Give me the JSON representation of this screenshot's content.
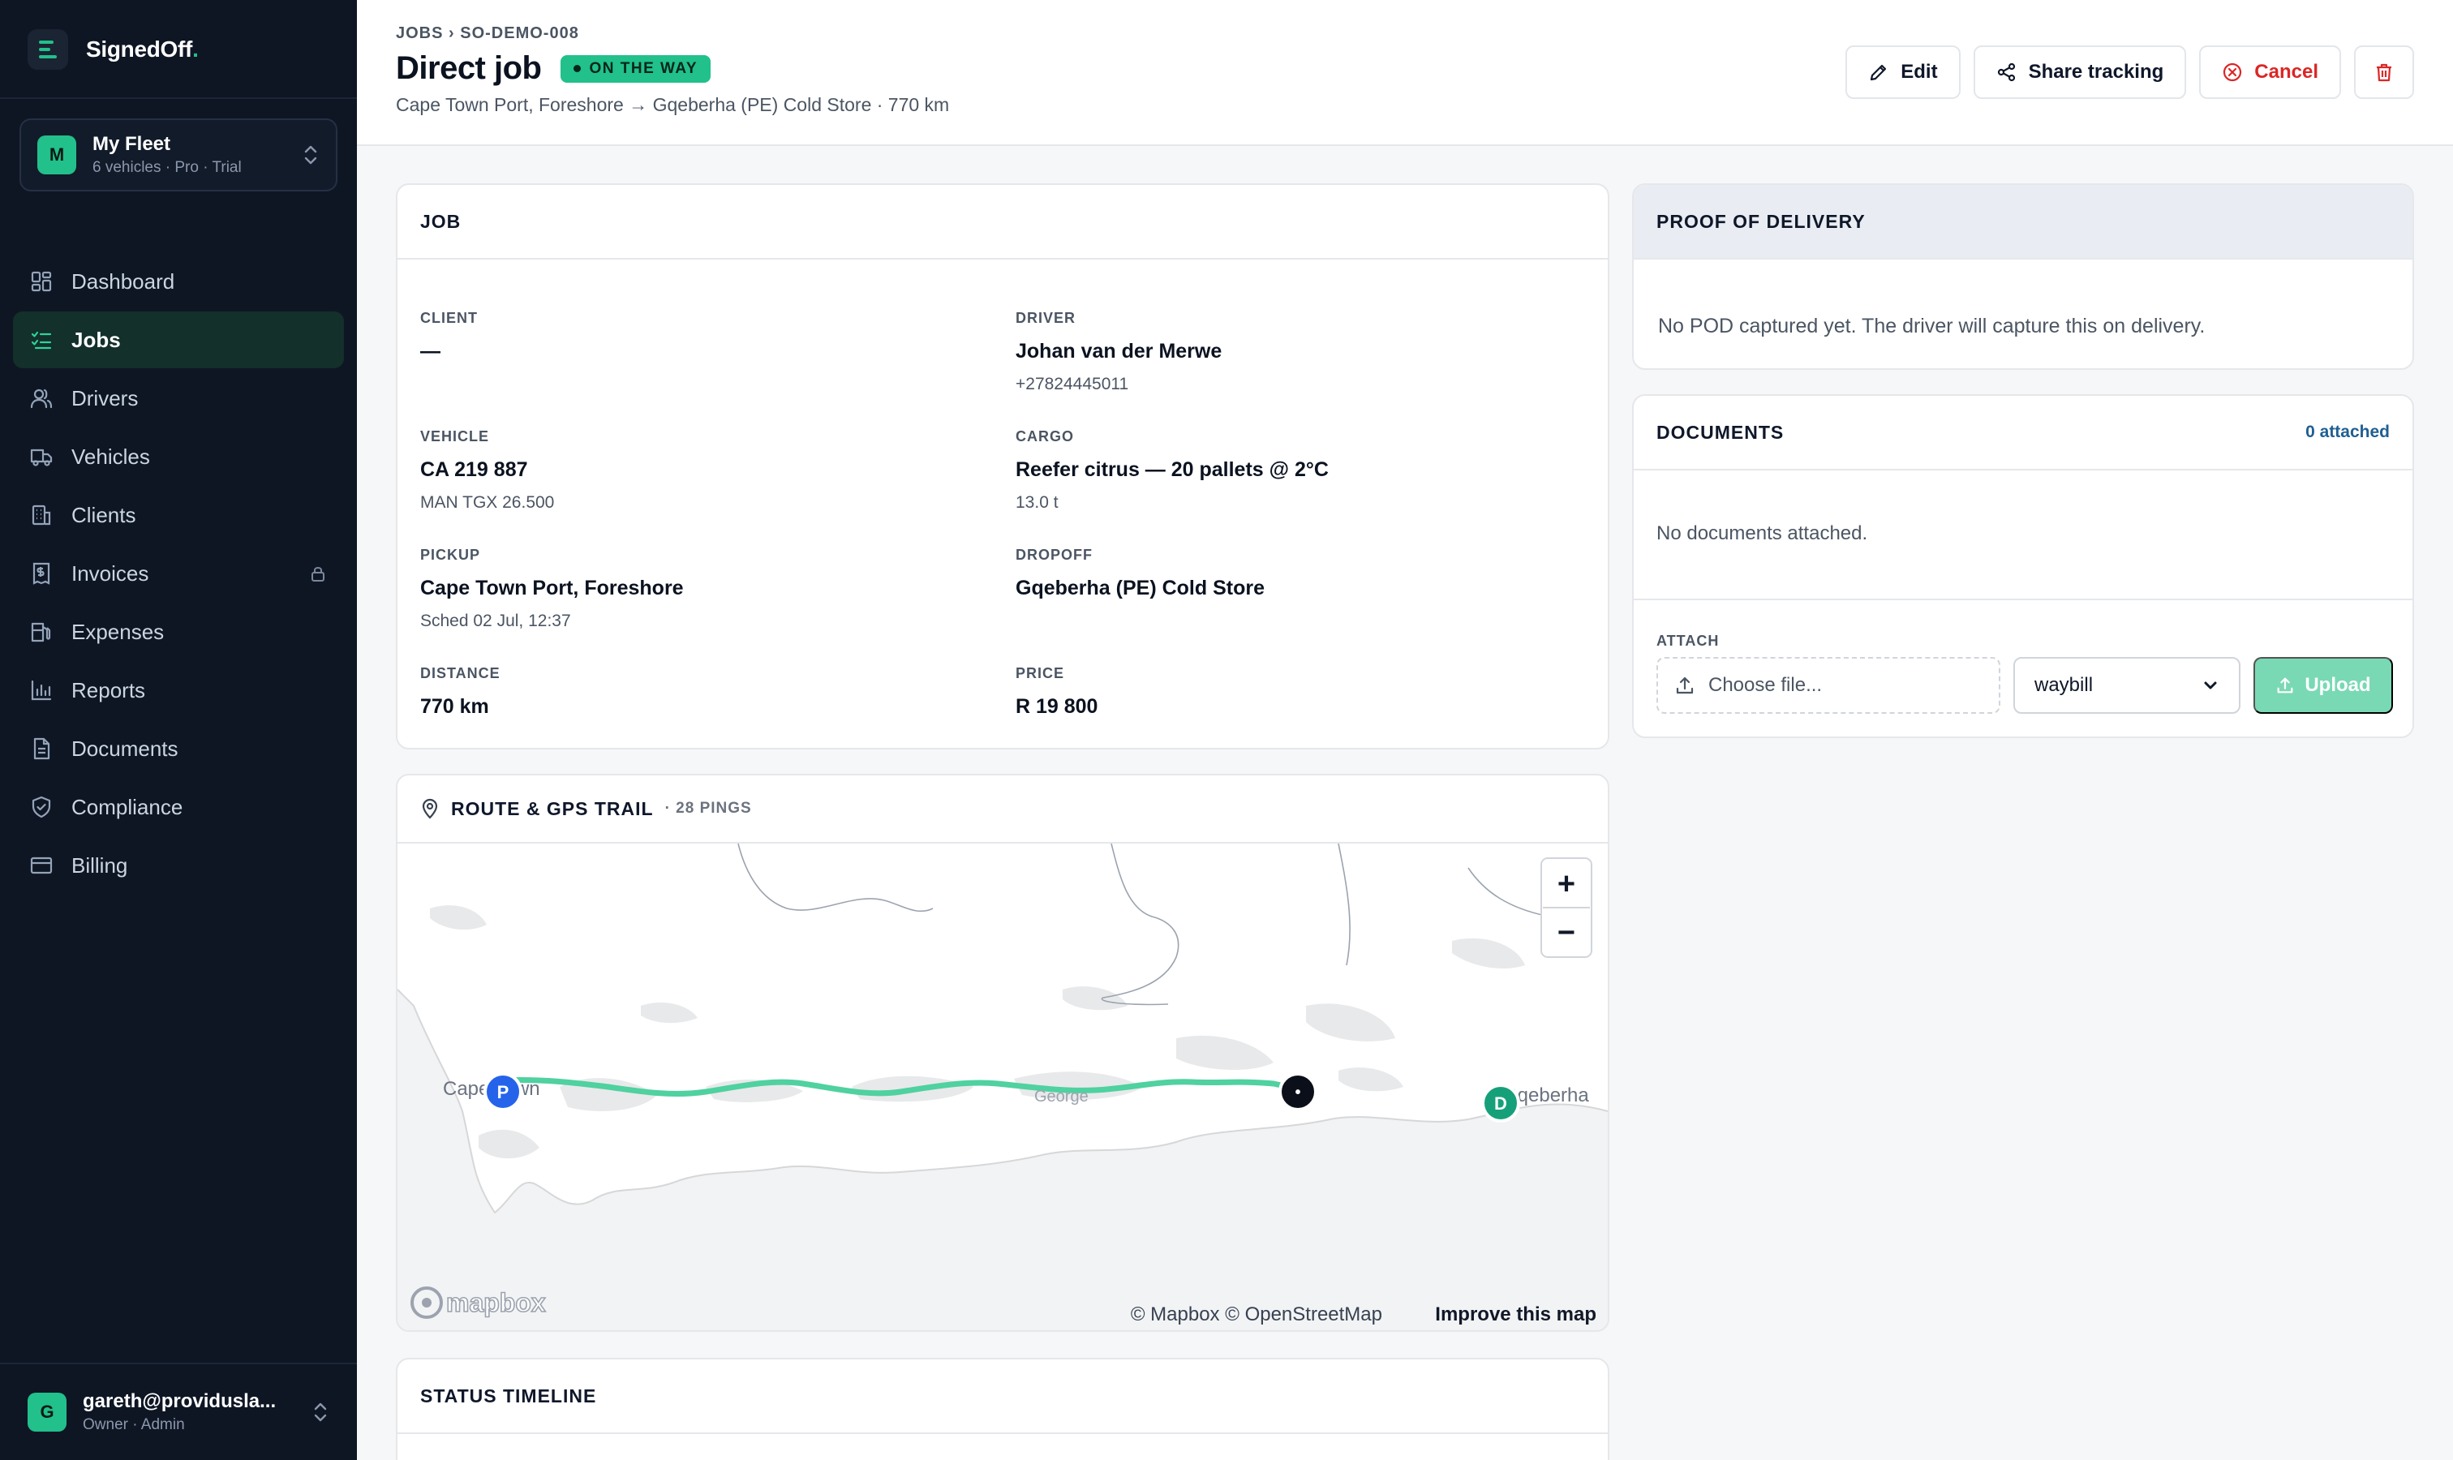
{
  "brand": {
    "name": "SignedOff",
    "dot": "."
  },
  "fleet": {
    "initial": "M",
    "name": "My Fleet",
    "sub": "6 vehicles · Pro · Trial"
  },
  "nav": [
    {
      "label": "Dashboard",
      "icon": "dashboard-icon"
    },
    {
      "label": "Jobs",
      "icon": "jobs-icon",
      "active": true
    },
    {
      "label": "Drivers",
      "icon": "drivers-icon"
    },
    {
      "label": "Vehicles",
      "icon": "truck-icon"
    },
    {
      "label": "Clients",
      "icon": "building-icon"
    },
    {
      "label": "Invoices",
      "icon": "invoice-icon",
      "locked": true
    },
    {
      "label": "Expenses",
      "icon": "fuel-icon"
    },
    {
      "label": "Reports",
      "icon": "chart-icon"
    },
    {
      "label": "Documents",
      "icon": "document-icon"
    },
    {
      "label": "Compliance",
      "icon": "shield-icon"
    },
    {
      "label": "Billing",
      "icon": "card-icon"
    }
  ],
  "user": {
    "initial": "G",
    "email": "gareth@providusla...",
    "role": "Owner · Admin"
  },
  "header": {
    "breadcrumb": "JOBS › SO-DEMO-008",
    "title": "Direct job",
    "status": "ON THE WAY",
    "subline": "Cape Town Port, Foreshore → Gqeberha (PE) Cold Store · 770 km",
    "actions": {
      "edit": "Edit",
      "share": "Share tracking",
      "cancel": "Cancel"
    }
  },
  "job": {
    "heading": "JOB",
    "client": {
      "label": "CLIENT",
      "value": "—"
    },
    "driver": {
      "label": "DRIVER",
      "value": "Johan van der Merwe",
      "sub": "+27824445011"
    },
    "vehicle": {
      "label": "VEHICLE",
      "value": "CA 219 887",
      "sub": "MAN TGX 26.500"
    },
    "cargo": {
      "label": "CARGO",
      "value": "Reefer citrus — 20 pallets @ 2°C",
      "sub": "13.0 t"
    },
    "pickup": {
      "label": "PICKUP",
      "value": "Cape Town Port, Foreshore",
      "sub": "Sched 02 Jul, 12:37"
    },
    "dropoff": {
      "label": "DROPOFF",
      "value": "Gqeberha (PE) Cold Store"
    },
    "distance": {
      "label": "DISTANCE",
      "value": "770 km"
    },
    "price": {
      "label": "PRICE",
      "value": "R 19 800"
    }
  },
  "route": {
    "heading": "ROUTE & GPS TRAIL",
    "pings": "· 28 PINGS",
    "map": {
      "city_west": "Cape Town",
      "city_mid": "George",
      "city_east": "Gqeberha",
      "pickup_marker": "P",
      "dropoff_marker": "D",
      "current_marker": "•",
      "zoom_in": "+",
      "zoom_out": "−",
      "logo": "mapbox",
      "attribution": "© Mapbox © OpenStreetMap",
      "improve": "Improve this map"
    }
  },
  "timeline": {
    "heading": "STATUS TIMELINE"
  },
  "pod": {
    "heading": "PROOF OF DELIVERY",
    "empty": "No POD captured yet. The driver will capture this on delivery."
  },
  "documents": {
    "heading": "DOCUMENTS",
    "count": "0 attached",
    "empty": "No documents attached.",
    "attach_label": "ATTACH",
    "file_placeholder": "Choose file...",
    "type": "waybill",
    "upload": "Upload"
  },
  "colors": {
    "accent": "#22c08b",
    "sidebar": "#0e1624",
    "route": "#4fd1a0",
    "pickup": "#2563eb",
    "danger": "#dc2626"
  }
}
